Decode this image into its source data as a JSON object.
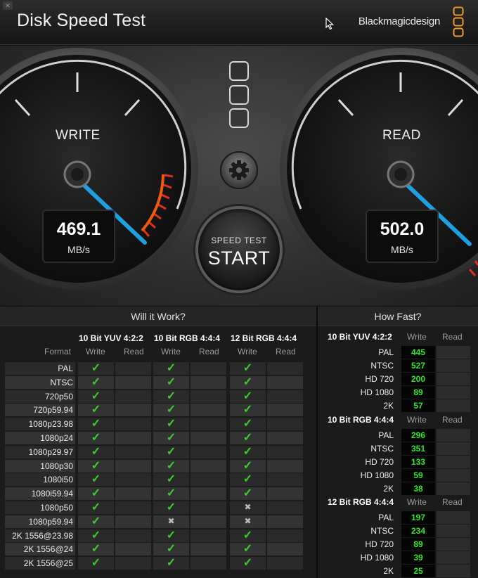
{
  "window": {
    "title": "Disk Speed Test",
    "brand": "Blackmagicdesign"
  },
  "gauges": {
    "write": {
      "label": "WRITE",
      "value": "469.1",
      "unit": "MB/s"
    },
    "read": {
      "label": "READ",
      "value": "502.0",
      "unit": "MB/s"
    }
  },
  "controls": {
    "start_small": "SPEED TEST",
    "start_big": "START"
  },
  "will_it_work": {
    "title": "Will it Work?",
    "format_label": "Format",
    "groups": [
      {
        "name": "10 Bit YUV 4:2:2",
        "write": "Write",
        "read": "Read"
      },
      {
        "name": "10 Bit RGB 4:4:4",
        "write": "Write",
        "read": "Read"
      },
      {
        "name": "12 Bit RGB 4:4:4",
        "write": "Write",
        "read": "Read"
      }
    ],
    "rows": [
      {
        "format": "PAL",
        "results": [
          "check",
          "check",
          "check"
        ]
      },
      {
        "format": "NTSC",
        "results": [
          "check",
          "check",
          "check"
        ]
      },
      {
        "format": "720p50",
        "results": [
          "check",
          "check",
          "check"
        ]
      },
      {
        "format": "720p59.94",
        "results": [
          "check",
          "check",
          "check"
        ]
      },
      {
        "format": "1080p23.98",
        "results": [
          "check",
          "check",
          "check"
        ]
      },
      {
        "format": "1080p24",
        "results": [
          "check",
          "check",
          "check"
        ]
      },
      {
        "format": "1080p29.97",
        "results": [
          "check",
          "check",
          "check"
        ]
      },
      {
        "format": "1080p30",
        "results": [
          "check",
          "check",
          "check"
        ]
      },
      {
        "format": "1080i50",
        "results": [
          "check",
          "check",
          "check"
        ]
      },
      {
        "format": "1080i59.94",
        "results": [
          "check",
          "check",
          "check"
        ]
      },
      {
        "format": "1080p50",
        "results": [
          "check",
          "check",
          "cross"
        ]
      },
      {
        "format": "1080p59.94",
        "results": [
          "check",
          "cross",
          "cross"
        ]
      },
      {
        "format": "2K 1556@23.98",
        "results": [
          "check",
          "check",
          "check"
        ]
      },
      {
        "format": "2K 1556@24",
        "results": [
          "check",
          "check",
          "check"
        ]
      },
      {
        "format": "2K 1556@25",
        "results": [
          "check",
          "check",
          "check"
        ]
      }
    ]
  },
  "how_fast": {
    "title": "How Fast?",
    "sections": [
      {
        "name": "10 Bit YUV 4:2:2",
        "write": "Write",
        "read": "Read",
        "rows": [
          {
            "format": "PAL",
            "value": "445"
          },
          {
            "format": "NTSC",
            "value": "527"
          },
          {
            "format": "HD 720",
            "value": "200"
          },
          {
            "format": "HD 1080",
            "value": "89"
          },
          {
            "format": "2K",
            "value": "57"
          }
        ]
      },
      {
        "name": "10 Bit RGB 4:4:4",
        "write": "Write",
        "read": "Read",
        "rows": [
          {
            "format": "PAL",
            "value": "296"
          },
          {
            "format": "NTSC",
            "value": "351"
          },
          {
            "format": "HD 720",
            "value": "133"
          },
          {
            "format": "HD 1080",
            "value": "59"
          },
          {
            "format": "2K",
            "value": "38"
          }
        ]
      },
      {
        "name": "12 Bit RGB 4:4:4",
        "write": "Write",
        "read": "Read",
        "rows": [
          {
            "format": "PAL",
            "value": "197"
          },
          {
            "format": "NTSC",
            "value": "234"
          },
          {
            "format": "HD 720",
            "value": "89"
          },
          {
            "format": "HD 1080",
            "value": "39"
          },
          {
            "format": "2K",
            "value": "25"
          }
        ]
      }
    ]
  },
  "icons": [
    "close-icon",
    "cursor-icon",
    "brand-logo-icon",
    "gear-icon",
    "check-icon",
    "cross-icon"
  ],
  "colors": {
    "accent_blue": "#1e9fe0",
    "red_zone": "#e0301e",
    "green_value": "#32e628",
    "check_green": "#3ecf2f"
  }
}
